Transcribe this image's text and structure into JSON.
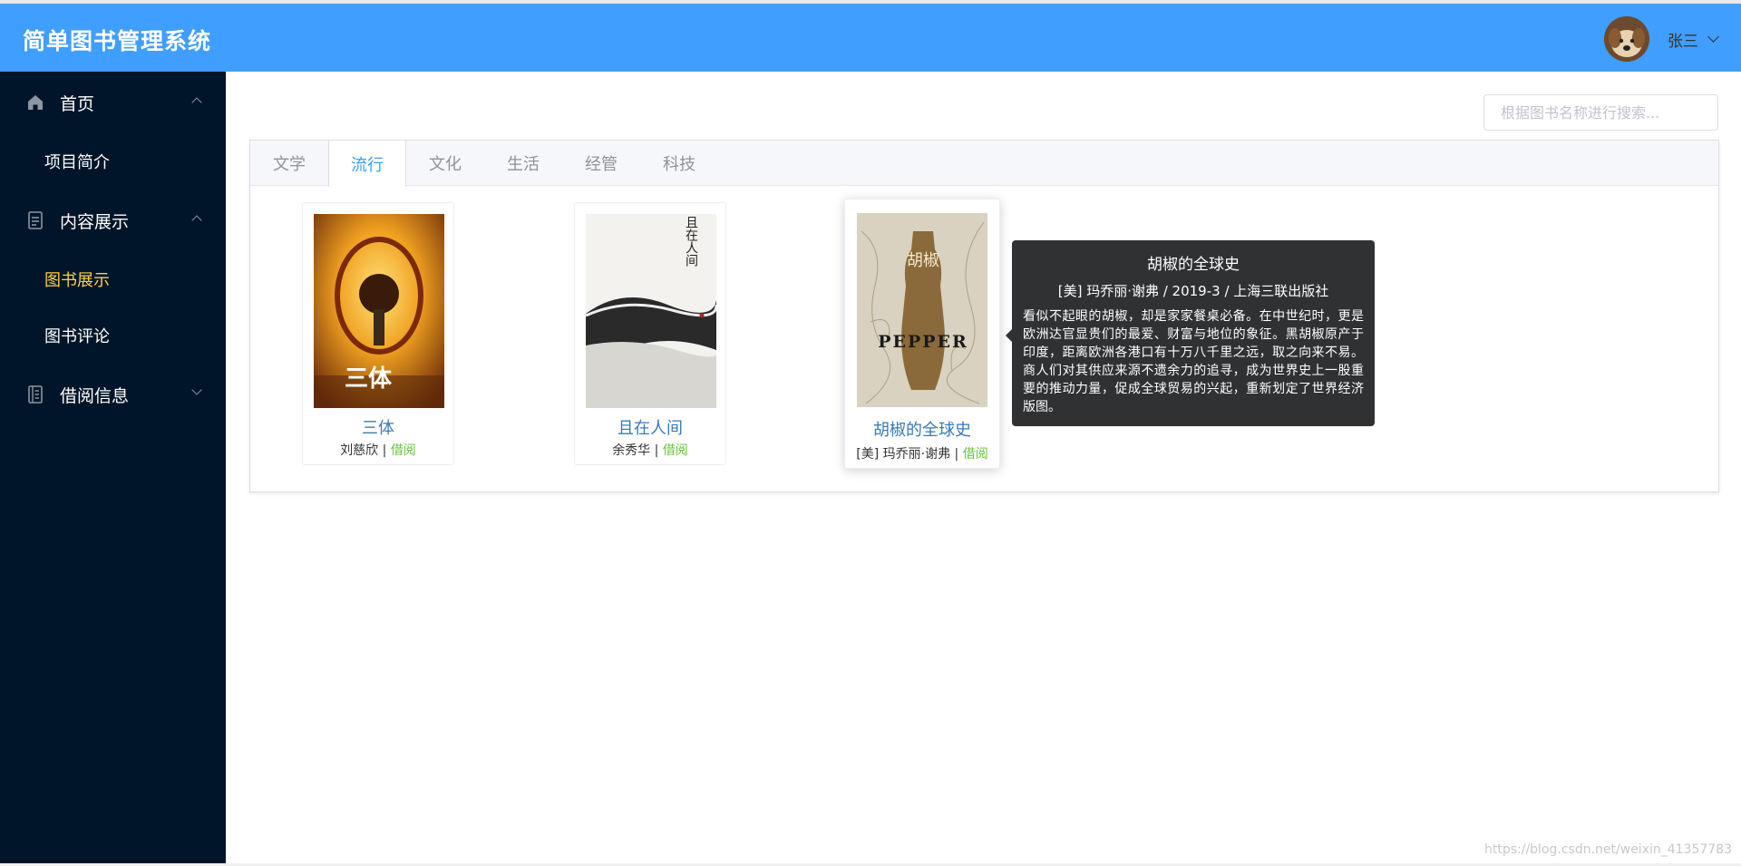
{
  "header": {
    "title": "简单图书管理系统",
    "user_name": "张三"
  },
  "sidebar": {
    "groups": [
      {
        "label": "首页",
        "icon": "home-icon",
        "expanded": true,
        "items": [
          {
            "label": "项目简介",
            "active": false
          }
        ]
      },
      {
        "label": "内容展示",
        "icon": "document-icon",
        "expanded": true,
        "items": [
          {
            "label": "图书展示",
            "active": true
          },
          {
            "label": "图书评论",
            "active": false
          }
        ]
      },
      {
        "label": "借阅信息",
        "icon": "notebook-icon",
        "expanded": false,
        "items": []
      }
    ]
  },
  "search": {
    "placeholder": "根据图书名称进行搜索..."
  },
  "tabs": [
    "文学",
    "流行",
    "文化",
    "生活",
    "经管",
    "科技"
  ],
  "active_tab": "流行",
  "books": [
    {
      "title": "三体",
      "author": "刘慈欣",
      "sep": " | ",
      "action": "借阅",
      "cover_text": "三体"
    },
    {
      "title": "且在人间",
      "author": "余秀华",
      "sep": " | ",
      "action": "借阅",
      "cover_text": "且在人间"
    },
    {
      "title": "胡椒的全球史",
      "author": "[美] 玛乔丽·谢弗",
      "sep": " | ",
      "action": "借阅",
      "cover_text": "胡椒",
      "cover_sub": "PEPPER"
    }
  ],
  "tooltip": {
    "title": "胡椒的全球史",
    "subtitle": "[美] 玛乔丽·谢弗 / 2019-3 / 上海三联出版社",
    "description": "看似不起眼的胡椒，却是家家餐桌必备。在中世纪时，更是欧洲达官显贵们的最爱、财富与地位的象征。黑胡椒原产于印度，距离欧洲各港口有十万八千里之远，取之向来不易。商人们对其供应来源不遗余力的追寻，成为世界史上一股重要的推动力量，促成全球贸易的兴起，重新划定了世界经济版图。"
  },
  "watermark": "https://blog.csdn.net/weixin_41357783",
  "colors": {
    "header": "#409EFF",
    "sidebar": "#001529",
    "active_menu": "#ffd04b",
    "accent": "#409EFF",
    "borrow": "#67c23a"
  }
}
